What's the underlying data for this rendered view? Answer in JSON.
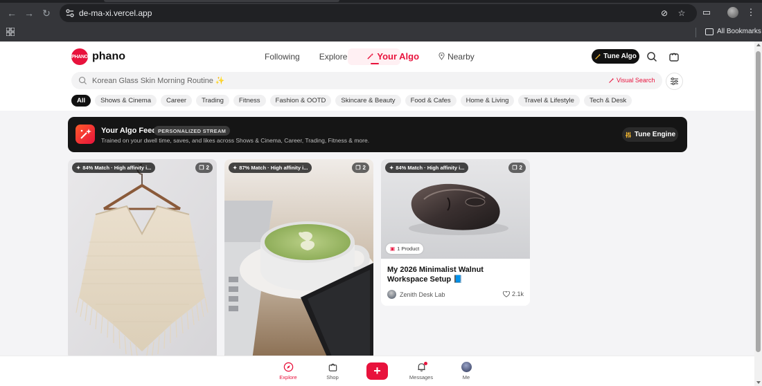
{
  "browser": {
    "url": "de-ma-xi.vercel.app",
    "bookmarks_label": "All Bookmarks"
  },
  "header": {
    "logo_mark": "PHANO",
    "logo_text": "phano",
    "nav": [
      "Following",
      "Explore",
      "Your Algo",
      "Nearby"
    ],
    "active_nav": "Your Algo",
    "tune_algo": "Tune Algo"
  },
  "search": {
    "placeholder": "Korean Glass Skin Morning Routine ✨",
    "visual_search": "Visual Search"
  },
  "chips": [
    "All",
    "Shows & Cinema",
    "Career",
    "Trading",
    "Fitness",
    "Fashion & OOTD",
    "Skincare & Beauty",
    "Food & Cafes",
    "Home & Living",
    "Travel & Lifestyle",
    "Tech & Desk"
  ],
  "banner": {
    "title": "Your Algo Feed",
    "badge": "PERSONALIZED STREAM",
    "subtitle": "Trained on your dwell time, saves, and likes across Shows & Cinema, Career, Trading, Fitness & more.",
    "tune_engine": "Tune Engine"
  },
  "cards": [
    {
      "match": "84% Match · High affinity i...",
      "count": "2"
    },
    {
      "match": "87% Match · High affinity i...",
      "count": "2"
    },
    {
      "match": "84% Match · High affinity i...",
      "count": "2",
      "product_tag": "1 Product",
      "title": "My 2026 Minimalist Walnut Workspace Setup 📘",
      "author": "Zenith Desk Lab",
      "likes": "2.1k"
    }
  ],
  "bottom_nav": {
    "explore": "Explore",
    "shop": "Shop",
    "add": "+",
    "messages": "Messages",
    "me": "Me"
  },
  "colors": {
    "accent": "#e8123c",
    "dark": "#151515"
  }
}
